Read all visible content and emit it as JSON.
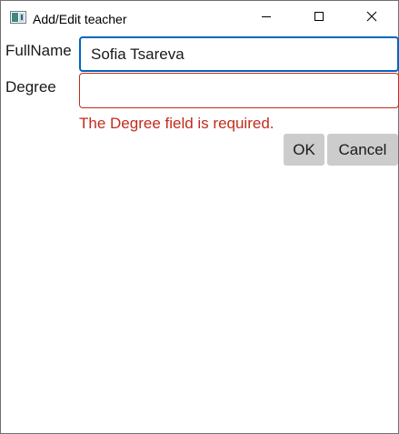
{
  "window": {
    "title": "Add/Edit teacher",
    "icon": "app-window-icon",
    "controls": [
      "minimize-icon",
      "maximize-icon",
      "close-icon"
    ]
  },
  "form": {
    "fullname": {
      "label": "FullName",
      "value": "Sofia Tsareva",
      "focused": true
    },
    "degree": {
      "label": "Degree",
      "value": "",
      "error": "The Degree field is required."
    }
  },
  "buttons": {
    "ok_label": "OK",
    "cancel_label": "Cancel"
  },
  "colors": {
    "focus_border": "#0067c0",
    "error": "#c42b1c",
    "button_bg": "#cccccc"
  }
}
